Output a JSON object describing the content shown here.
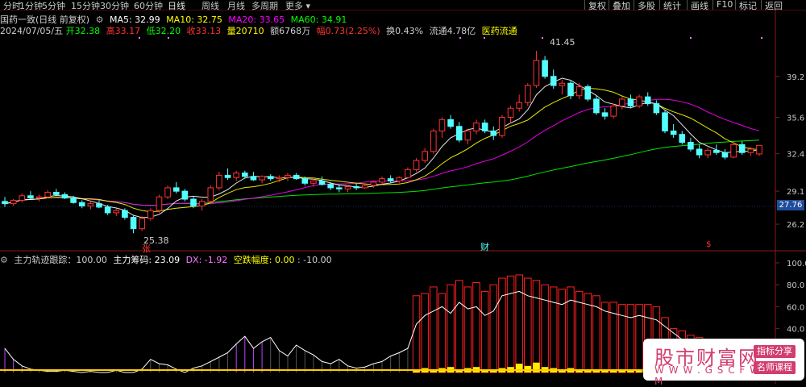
{
  "toolbar": {
    "periods": [
      "分时",
      "1分钟",
      "5分钟",
      "15分钟",
      "30分钟",
      "60分钟",
      "日线",
      "周线",
      "月线",
      "多周期",
      "更多"
    ],
    "active_period": "日线",
    "right_buttons": [
      "复权",
      "叠加",
      "多股",
      "统计",
      "画线",
      "F10",
      "标记",
      "返回"
    ]
  },
  "header": {
    "stock_title": "国药一致(日线 前复权)",
    "ma5_label": "MA5: 32.99",
    "ma10_label": "MA10: 32.75",
    "ma20_label": "MA20: 33.65",
    "ma60_label": "MA60: 34.91",
    "date": "2024/07/05/五",
    "open": "开32.38",
    "high": "高33.17",
    "low": "低32.20",
    "close": "收33.13",
    "volume": "量20710",
    "amount": "额6768万",
    "change": "幅0.73(2.25%)",
    "turnover": "换0.43%",
    "float": "流通4.78亿",
    "sector": "医药流通"
  },
  "colors": {
    "up": "#ff3232",
    "down": "#54ffff",
    "ma5": "#ffffff",
    "ma10": "#ffff00",
    "ma20": "#ff00ff",
    "ma60": "#00ff00",
    "title_pink": "#ff77ff"
  },
  "price_axis": [
    "39.2",
    "35.6",
    "32.4",
    "29.1",
    "26.2"
  ],
  "current_price": "27.76",
  "annotations": {
    "high": "41.45",
    "low": "25.38",
    "zhang_mark": "张",
    "cai_mark": "财",
    "dollar_mark": "$"
  },
  "indicator": {
    "title": "主力轨迹跟踪：100.00",
    "chip": "主力筹码: 23.09",
    "dx": "DX: -1.92",
    "range": "空跌幅度: 0.00",
    "range2": ": -10.00",
    "axis": [
      "100.0",
      "80.0",
      "60.0",
      "40.0"
    ]
  },
  "watermark": {
    "title": "股市财富网",
    "url": "W W W . G S C F W . C O M",
    "tag1": "指标分享",
    "tag2": "名师课程"
  },
  "chart_data": {
    "type": "candlestick",
    "title": "国药一致(日线 前复权)",
    "ylim": [
      24.5,
      42.8
    ],
    "candles": [
      [
        28.2,
        28.6,
        27.7,
        28.0
      ],
      [
        28.0,
        28.4,
        27.8,
        28.3
      ],
      [
        28.3,
        28.9,
        28.1,
        28.7
      ],
      [
        28.7,
        29.1,
        28.4,
        28.5
      ],
      [
        28.5,
        28.8,
        28.2,
        28.6
      ],
      [
        28.6,
        29.2,
        28.5,
        29.0
      ],
      [
        29.0,
        29.3,
        28.7,
        28.8
      ],
      [
        28.8,
        29.0,
        28.4,
        28.5
      ],
      [
        28.5,
        28.7,
        28.0,
        28.1
      ],
      [
        28.1,
        28.3,
        27.6,
        27.8
      ],
      [
        27.8,
        28.2,
        27.5,
        28.0
      ],
      [
        28.0,
        28.3,
        27.6,
        27.7
      ],
      [
        27.7,
        27.9,
        27.0,
        27.2
      ],
      [
        27.2,
        27.6,
        26.9,
        27.4
      ],
      [
        27.4,
        27.6,
        26.6,
        26.8
      ],
      [
        26.8,
        27.0,
        25.4,
        25.8
      ],
      [
        25.8,
        26.9,
        25.6,
        26.7
      ],
      [
        26.7,
        27.6,
        26.5,
        27.4
      ],
      [
        27.4,
        28.8,
        27.2,
        28.6
      ],
      [
        28.6,
        29.6,
        28.4,
        29.4
      ],
      [
        29.4,
        29.9,
        28.9,
        29.1
      ],
      [
        29.1,
        29.3,
        28.2,
        28.4
      ],
      [
        28.4,
        28.6,
        27.6,
        27.8
      ],
      [
        27.8,
        28.4,
        27.4,
        28.2
      ],
      [
        28.2,
        29.6,
        28.0,
        29.4
      ],
      [
        29.4,
        30.8,
        29.2,
        30.5
      ],
      [
        30.5,
        31.1,
        30.1,
        30.3
      ],
      [
        30.3,
        30.9,
        30.0,
        30.7
      ],
      [
        30.7,
        30.9,
        30.2,
        30.4
      ],
      [
        30.4,
        30.8,
        30.0,
        30.1
      ],
      [
        30.1,
        30.5,
        29.8,
        30.4
      ],
      [
        30.4,
        30.6,
        30.0,
        30.2
      ],
      [
        30.2,
        30.5,
        29.9,
        30.3
      ],
      [
        30.3,
        30.7,
        30.0,
        30.5
      ],
      [
        30.5,
        30.7,
        30.1,
        30.2
      ],
      [
        30.2,
        30.4,
        29.6,
        29.8
      ],
      [
        29.8,
        30.2,
        29.5,
        30.0
      ],
      [
        30.0,
        30.4,
        29.6,
        29.7
      ],
      [
        29.7,
        29.9,
        29.2,
        29.4
      ],
      [
        29.4,
        29.7,
        29.0,
        29.3
      ],
      [
        29.3,
        29.6,
        29.0,
        29.5
      ],
      [
        29.5,
        29.8,
        29.2,
        29.4
      ],
      [
        29.4,
        29.7,
        29.3,
        29.6
      ],
      [
        29.6,
        30.0,
        29.4,
        29.9
      ],
      [
        29.9,
        30.4,
        29.7,
        30.2
      ],
      [
        30.2,
        30.5,
        29.8,
        30.0
      ],
      [
        30.0,
        30.4,
        29.8,
        30.3
      ],
      [
        30.3,
        31.2,
        30.2,
        31.0
      ],
      [
        31.0,
        32.0,
        30.8,
        31.8
      ],
      [
        31.8,
        32.9,
        31.6,
        32.6
      ],
      [
        32.6,
        34.6,
        32.4,
        34.4
      ],
      [
        34.4,
        35.6,
        33.8,
        35.4
      ],
      [
        35.4,
        35.8,
        34.6,
        34.8
      ],
      [
        34.8,
        35.2,
        33.4,
        33.6
      ],
      [
        33.6,
        34.6,
        33.2,
        34.4
      ],
      [
        34.4,
        35.4,
        34.1,
        35.1
      ],
      [
        35.1,
        35.4,
        34.2,
        34.4
      ],
      [
        34.4,
        34.8,
        33.6,
        34.0
      ],
      [
        34.0,
        35.8,
        33.8,
        35.6
      ],
      [
        35.6,
        36.6,
        35.1,
        36.4
      ],
      [
        36.4,
        37.6,
        36.1,
        36.9
      ],
      [
        36.9,
        38.6,
        36.6,
        38.4
      ],
      [
        38.4,
        41.45,
        38.2,
        40.6
      ],
      [
        40.6,
        41.0,
        39.0,
        39.2
      ],
      [
        39.2,
        39.8,
        38.1,
        38.4
      ],
      [
        38.4,
        38.9,
        37.6,
        38.6
      ],
      [
        38.6,
        38.8,
        37.2,
        37.5
      ],
      [
        37.5,
        38.6,
        37.2,
        38.3
      ],
      [
        38.3,
        38.5,
        37.0,
        37.2
      ],
      [
        37.2,
        37.5,
        35.8,
        36.0
      ],
      [
        36.0,
        36.4,
        35.4,
        35.7
      ],
      [
        35.7,
        36.8,
        35.5,
        36.6
      ],
      [
        36.6,
        37.4,
        36.3,
        37.2
      ],
      [
        37.2,
        37.6,
        36.4,
        36.6
      ],
      [
        36.6,
        37.6,
        36.4,
        37.4
      ],
      [
        37.4,
        37.8,
        36.6,
        36.8
      ],
      [
        36.8,
        37.1,
        35.8,
        36.0
      ],
      [
        36.0,
        36.2,
        34.2,
        34.4
      ],
      [
        34.4,
        35.0,
        33.8,
        34.1
      ],
      [
        34.1,
        34.4,
        33.2,
        33.4
      ],
      [
        33.4,
        33.8,
        32.6,
        32.8
      ],
      [
        32.8,
        33.2,
        32.0,
        32.3
      ],
      [
        32.3,
        32.9,
        32.0,
        32.7
      ],
      [
        32.7,
        33.2,
        32.3,
        32.5
      ],
      [
        32.5,
        32.8,
        31.9,
        32.1
      ],
      [
        32.1,
        33.4,
        32.0,
        33.2
      ],
      [
        33.2,
        33.5,
        32.3,
        32.5
      ],
      [
        32.5,
        33.0,
        32.2,
        32.8
      ],
      [
        32.38,
        33.17,
        32.2,
        33.13
      ]
    ],
    "ma5_last": 32.99,
    "ma10_last": 32.75,
    "ma20_last": 33.65,
    "ma60_last": 34.91,
    "indicator_values": [
      [
        0,
        22,
        0
      ],
      [
        0,
        12,
        0
      ],
      [
        0,
        6,
        0
      ],
      [
        0,
        3,
        0
      ],
      [
        0,
        2,
        0
      ],
      [
        0,
        1,
        0
      ],
      [
        0,
        1,
        0
      ],
      [
        0,
        2,
        0
      ],
      [
        0,
        1,
        0
      ],
      [
        0,
        0,
        0
      ],
      [
        0,
        1,
        0
      ],
      [
        0,
        0,
        0
      ],
      [
        0,
        0,
        0
      ],
      [
        0,
        2,
        0
      ],
      [
        0,
        0,
        0
      ],
      [
        0,
        0,
        0
      ],
      [
        0,
        3,
        0
      ],
      [
        0,
        12,
        0
      ],
      [
        0,
        8,
        0
      ],
      [
        0,
        7,
        0
      ],
      [
        0,
        3,
        0
      ],
      [
        0,
        0,
        0
      ],
      [
        0,
        4,
        0
      ],
      [
        0,
        6,
        0
      ],
      [
        0,
        10,
        0
      ],
      [
        0,
        14,
        0
      ],
      [
        0,
        18,
        0
      ],
      [
        0,
        26,
        0
      ],
      [
        0,
        33,
        0
      ],
      [
        0,
        22,
        0
      ],
      [
        0,
        28,
        0
      ],
      [
        0,
        32,
        0
      ],
      [
        0,
        20,
        0
      ],
      [
        0,
        15,
        0
      ],
      [
        0,
        25,
        0
      ],
      [
        0,
        20,
        0
      ],
      [
        0,
        16,
        0
      ],
      [
        0,
        10,
        0
      ],
      [
        0,
        8,
        0
      ],
      [
        0,
        12,
        0
      ],
      [
        0,
        6,
        0
      ],
      [
        0,
        4,
        0
      ],
      [
        0,
        5,
        0
      ],
      [
        0,
        8,
        0
      ],
      [
        0,
        10,
        0
      ],
      [
        0,
        15,
        0
      ],
      [
        0,
        18,
        0
      ],
      [
        0,
        22,
        0
      ],
      [
        70,
        44,
        3
      ],
      [
        72,
        52,
        4
      ],
      [
        78,
        56,
        3
      ],
      [
        72,
        60,
        4
      ],
      [
        80,
        54,
        5
      ],
      [
        84,
        64,
        3
      ],
      [
        78,
        58,
        4
      ],
      [
        82,
        60,
        5
      ],
      [
        74,
        52,
        3
      ],
      [
        80,
        56,
        2
      ],
      [
        86,
        70,
        4
      ],
      [
        88,
        72,
        5
      ],
      [
        89,
        74,
        8
      ],
      [
        86,
        70,
        6
      ],
      [
        84,
        68,
        9
      ],
      [
        80,
        66,
        5
      ],
      [
        78,
        64,
        4
      ],
      [
        76,
        62,
        3
      ],
      [
        78,
        66,
        4
      ],
      [
        74,
        64,
        3
      ],
      [
        72,
        62,
        2
      ],
      [
        70,
        60,
        3
      ],
      [
        64,
        56,
        2
      ],
      [
        64,
        54,
        2
      ],
      [
        62,
        52,
        3
      ],
      [
        62,
        50,
        2
      ],
      [
        62,
        52,
        2
      ],
      [
        62,
        50,
        2
      ],
      [
        60,
        48,
        2
      ],
      [
        50,
        42,
        1
      ],
      [
        40,
        36,
        1
      ],
      [
        38,
        30,
        1
      ],
      [
        34,
        28,
        1
      ],
      [
        32,
        26,
        0
      ],
      [
        24,
        18,
        0
      ],
      [
        22,
        16,
        0
      ],
      [
        18,
        12,
        0
      ],
      [
        14,
        10,
        0
      ],
      [
        12,
        8,
        0
      ],
      [
        10,
        6,
        0
      ],
      [
        8,
        4,
        0
      ]
    ]
  }
}
